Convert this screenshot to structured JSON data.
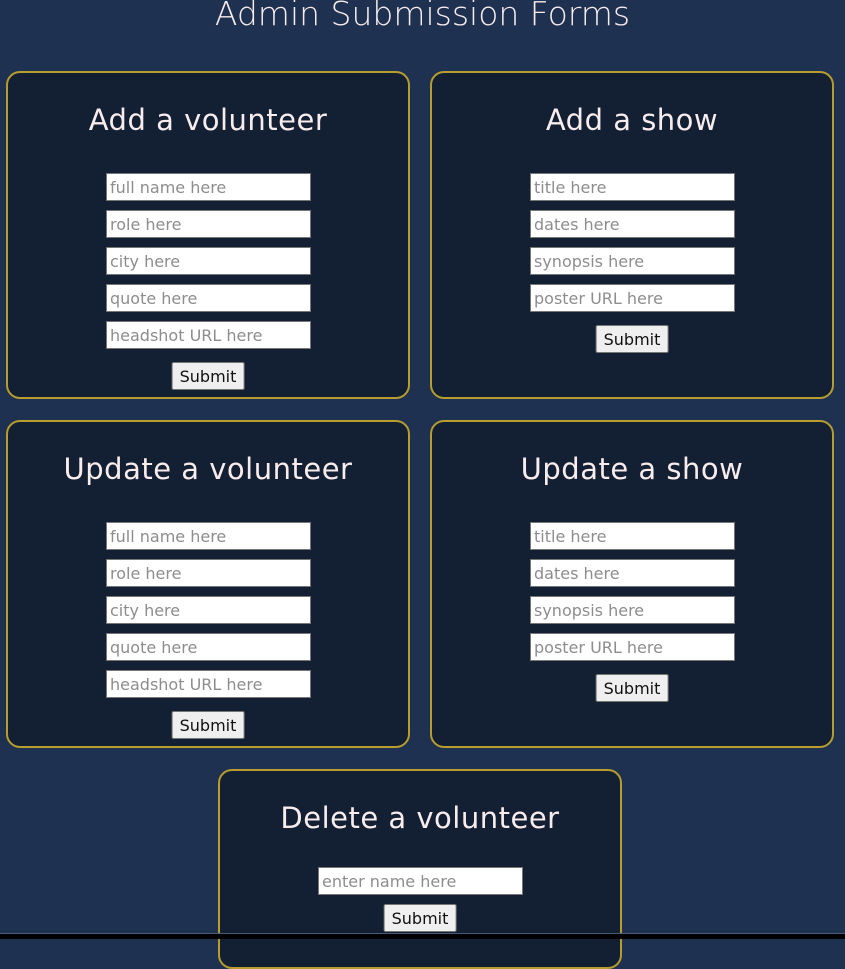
{
  "page": {
    "title": "Admin Submission Forms"
  },
  "colors": {
    "background": "#1f3150",
    "card": "#131f33",
    "border": "#b89c2e",
    "heading": "#f8ecec"
  },
  "forms": {
    "add_volunteer": {
      "title": "Add a volunteer",
      "fields": [
        "full name here",
        "role here",
        "city here",
        "quote here",
        "headshot URL here"
      ],
      "submit": "Submit"
    },
    "add_show": {
      "title": "Add a show",
      "fields": [
        "title here",
        "dates here",
        "synopsis here",
        "poster URL here"
      ],
      "submit": "Submit"
    },
    "update_volunteer": {
      "title": "Update a volunteer",
      "fields": [
        "full name here",
        "role here",
        "city here",
        "quote here",
        "headshot URL here"
      ],
      "submit": "Submit"
    },
    "update_show": {
      "title": "Update a show",
      "fields": [
        "title here",
        "dates here",
        "synopsis here",
        "poster URL here"
      ],
      "submit": "Submit"
    },
    "delete_volunteer": {
      "title": "Delete a volunteer",
      "fields": [
        "enter name here"
      ],
      "submit": "Submit"
    }
  }
}
